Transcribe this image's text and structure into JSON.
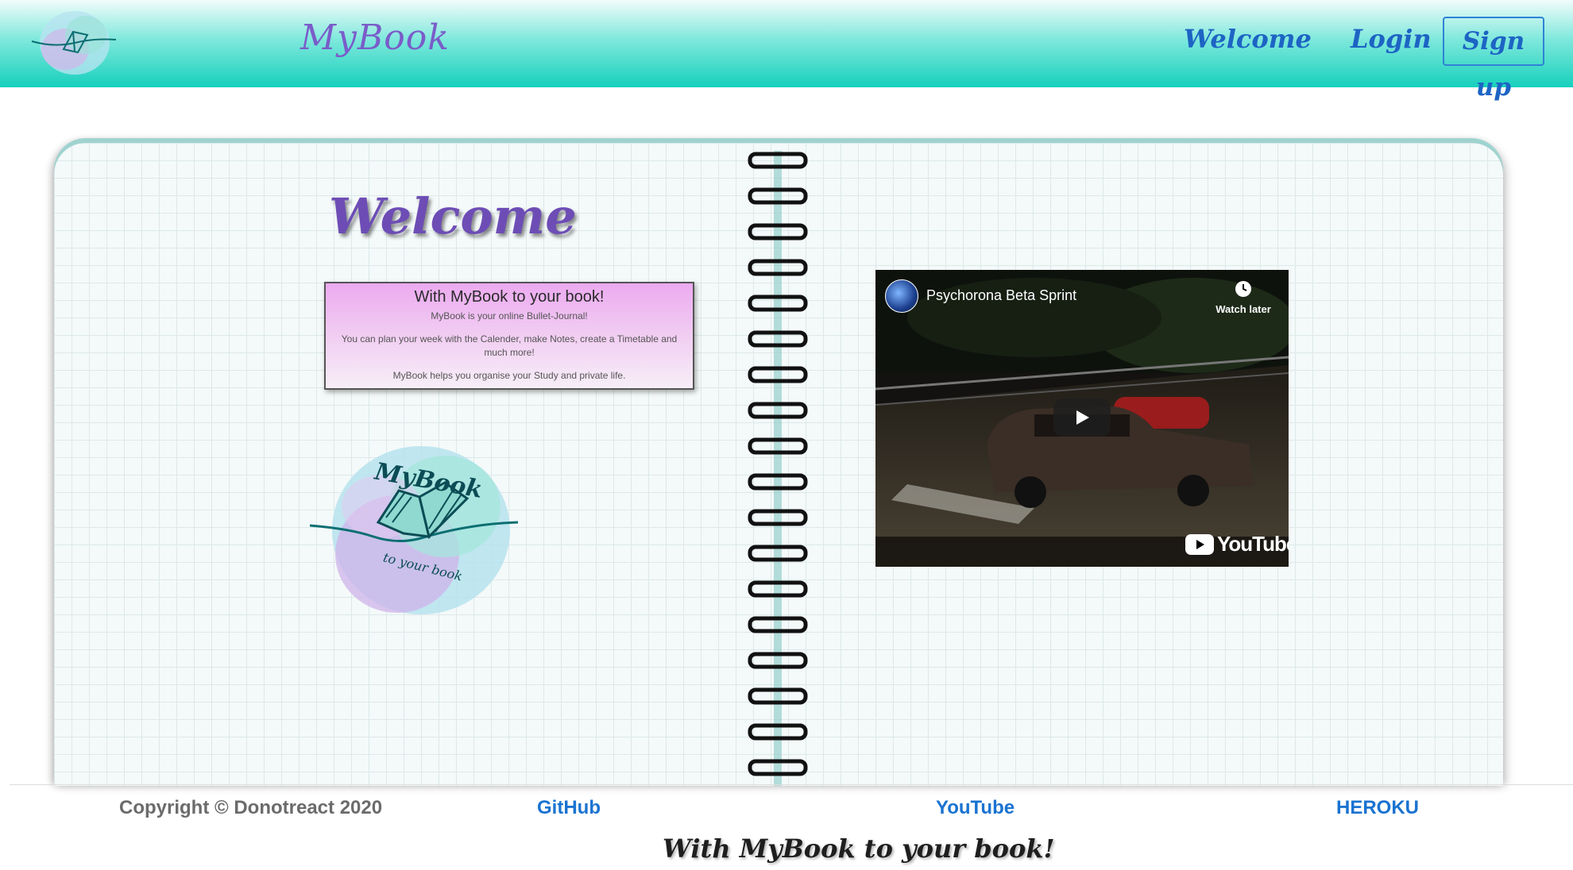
{
  "navbar": {
    "brand": "MyBook",
    "links": {
      "welcome": "Welcome",
      "login": "Login",
      "signup": "Sign up"
    },
    "logo_icon": "mybook-logo"
  },
  "main": {
    "heading": "Welcome",
    "card": {
      "title": "With MyBook to your book!",
      "line1": "MyBook is your online Bullet-Journal!",
      "line2": "You can plan your week with the Calender, make Notes, create a Timetable and much more!",
      "line3": "MyBook helps you organise your Study and private life."
    },
    "logo_icon": "mybook-logo"
  },
  "video": {
    "title": "Psychorona Beta Sprint",
    "watch_later": "Watch later",
    "brand": "YouTube",
    "play_icon": "play-icon",
    "clock_icon": "clock-icon"
  },
  "footer": {
    "copyright": "Copyright © Donotreact 2020",
    "links": {
      "github": "GitHub",
      "youtube": "YouTube",
      "heroku": "HEROKU"
    },
    "tagline": "With MyBook to your book!"
  },
  "colors": {
    "navbar_top": "#f1fcfb",
    "navbar_bottom": "#16d0bd",
    "brand_purple": "#7a5cc9",
    "link_blue": "#1a73d1",
    "card_pink": "#ecaaf0"
  }
}
